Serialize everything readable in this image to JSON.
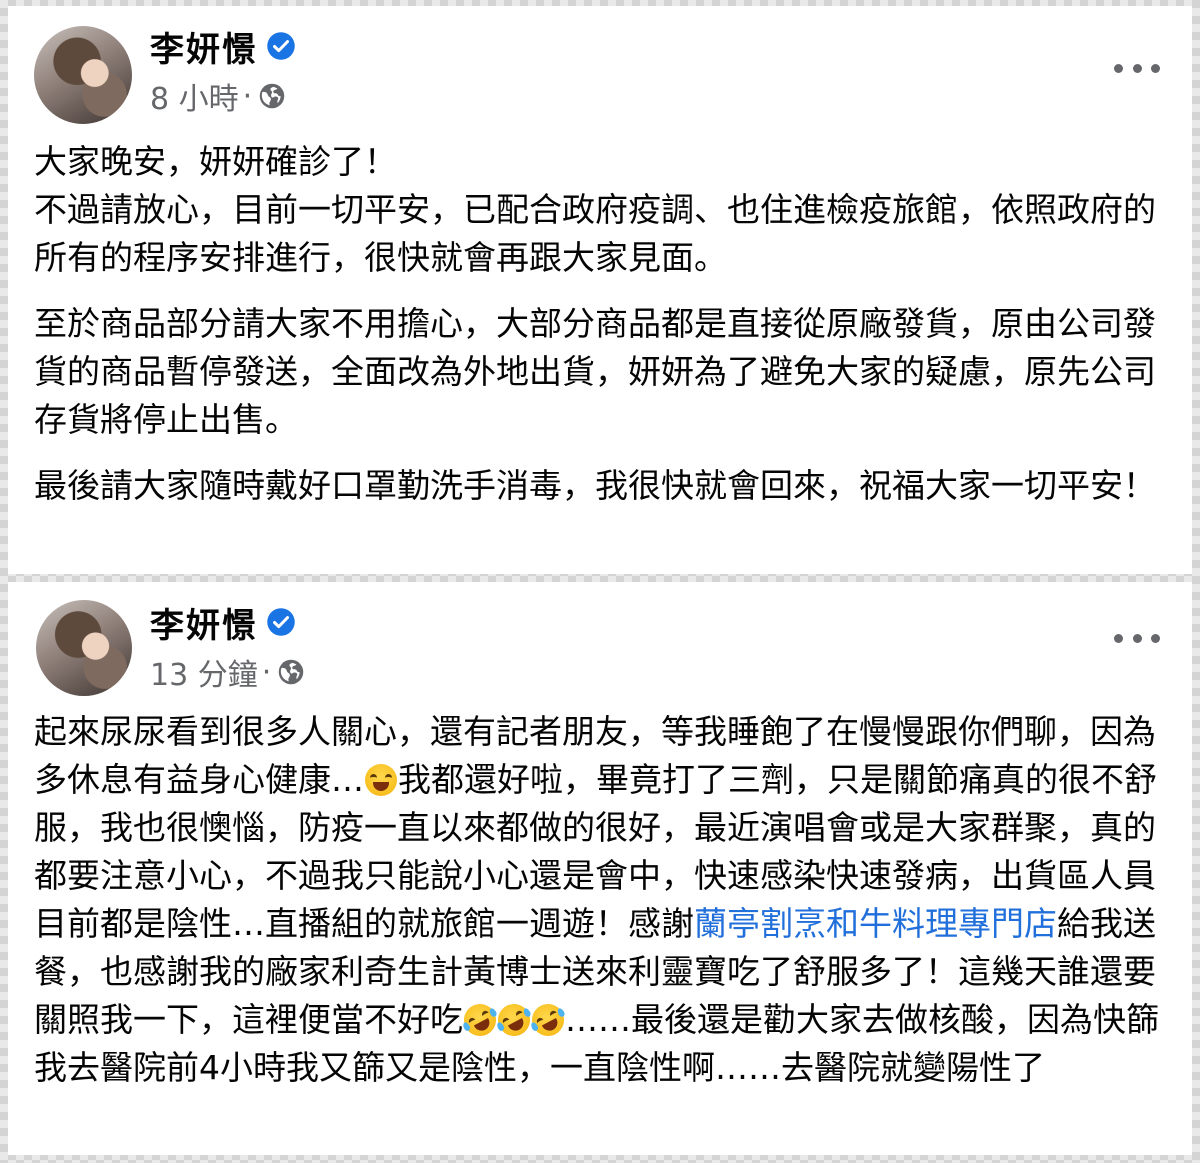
{
  "posts": [
    {
      "author": "李妍憬",
      "time": "8 小時",
      "dot": "·",
      "paragraphs": [
        "大家晚安，妍妍確診了！\n不過請放心，目前一切平安，已配合政府疫調、也住進檢疫旅館，依照政府的所有的程序安排進行，很快就會再跟大家見面。",
        "至於商品部分請大家不用擔心，大部分商品都是直接從原廠發貨，原由公司發貨的商品暫停發送，全面改為外地出貨，妍妍為了避免大家的疑慮，原先公司存貨將停止出售。",
        "最後請大家隨時戴好口罩勤洗手消毒，我很快就會回來，祝福大家一切平安！"
      ]
    },
    {
      "author": "李妍憬",
      "time": "13 分鐘",
      "dot": "·",
      "text_a": "起來尿尿看到很多人關心，還有記者朋友，等我睡飽了在慢慢跟你們聊，因為多休息有益身心健康…",
      "text_b": "我都還好啦，畢竟打了三劑，只是關節痛真的很不舒服，我也很懊惱，防疫一直以來都做的很好，最近演唱會或是大家群聚，真的都要注意小心，不過我只能說小心還是會中，快速感染快速發病，出貨區人員目前都是陰性…直播組的就旅館一週遊！感謝",
      "link_text": "蘭亭割烹和牛料理專門店",
      "text_c": "給我送餐，也感謝我的廠家利奇生計黃博士送來利靈寶吃了舒服多了！這幾天誰還要關照我一下，這裡便當不好吃",
      "text_d": "……最後還是勸大家去做核酸，因為快篩我去醫院前4小時我又篩又是陰性，一直陰性啊……去醫院就變陽性了",
      "emoji_1": "grinning-squinting-face",
      "emoji_rofl": "rolling-on-the-floor-laughing"
    }
  ],
  "colors": {
    "text": "#050505",
    "meta": "#65676b",
    "link": "#216fdb",
    "verified": "#1b74e4"
  }
}
